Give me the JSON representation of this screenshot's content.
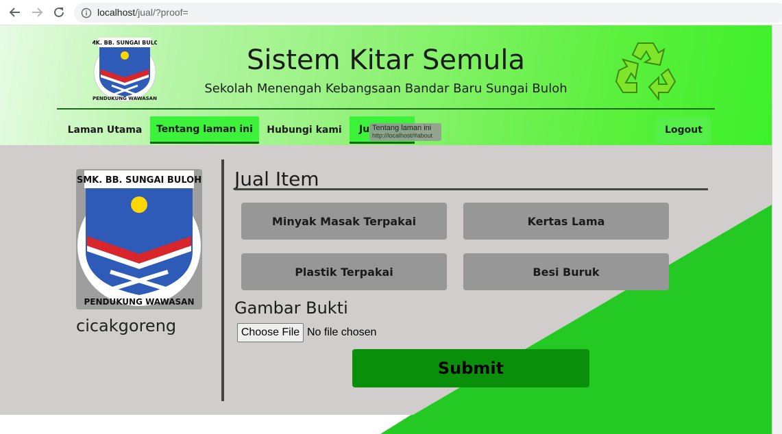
{
  "browser": {
    "url_host": "localhost",
    "url_path": "/jual/?proof="
  },
  "header": {
    "title": "Sistem Kitar Semula",
    "subtitle": "Sekolah Menengah Kebangsaan Bandar Baru Sungai Buloh",
    "logo_text_top": "SMK. BB. SUNGAI BULOH",
    "logo_text_bottom": "PENDUKUNG WAWASAN"
  },
  "nav": {
    "items": [
      {
        "label": "Laman Utama"
      },
      {
        "label": "Tentang laman ini"
      },
      {
        "label": "Hubungi kami"
      },
      {
        "label": "Ju"
      }
    ],
    "logout": "Logout",
    "tooltip_title": "Tentang laman ini",
    "tooltip_url": "http://localhost/#about"
  },
  "profile": {
    "username": "cicakgoreng"
  },
  "form": {
    "title": "Jual Item",
    "items": [
      {
        "label": "Minyak Masak Terpakai"
      },
      {
        "label": "Kertas Lama"
      },
      {
        "label": "Plastik Terpakai"
      },
      {
        "label": "Besi Buruk"
      }
    ],
    "proof_title": "Gambar Bukti",
    "file_button": "Choose File",
    "file_status": "No file chosen",
    "submit": "Submit"
  },
  "colors": {
    "header_green": "#3df02a",
    "nav_active": "#3df23a",
    "content_bg": "#d0cdcc",
    "item_button": "#979797",
    "submit_green": "#0a8f0a",
    "triangle_green": "#24c924"
  }
}
